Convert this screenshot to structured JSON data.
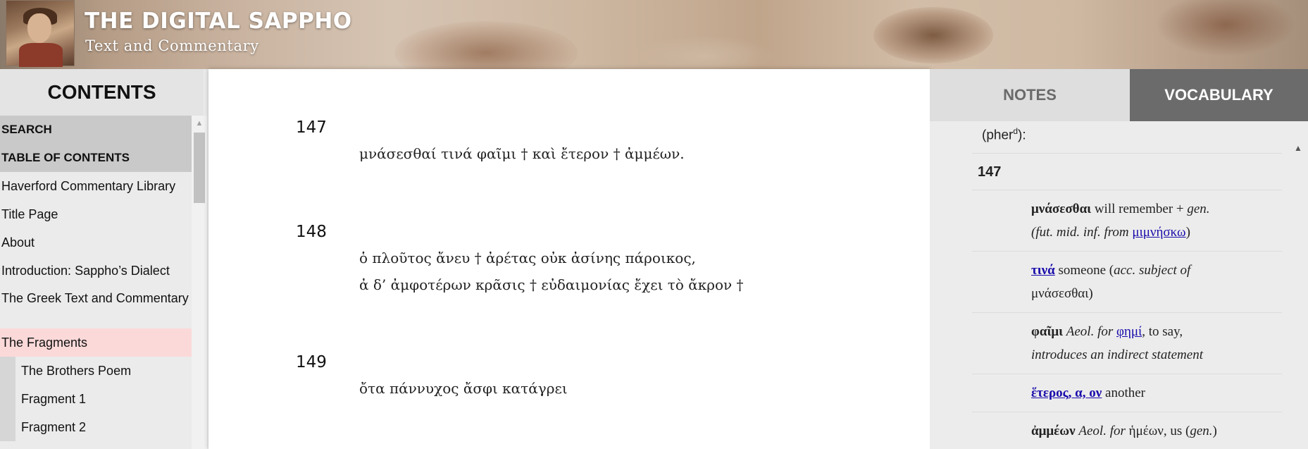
{
  "header": {
    "title": "THE DIGITAL SAPPHO",
    "subtitle": "Text and Commentary",
    "logo_icon": "sappho-portrait"
  },
  "sidebar": {
    "heading": "CONTENTS",
    "sections": [
      "SEARCH",
      "TABLE OF CONTENTS"
    ],
    "items": [
      "Haverford Commentary Library",
      "Title Page",
      "About",
      "Introduction: Sappho’s Dialect",
      "The Greek Text and Commentary",
      "The Fragments"
    ],
    "active_item": "The Fragments",
    "subitems": [
      "The Brothers Poem",
      "Fragment 1",
      "Fragment 2"
    ]
  },
  "main": {
    "fragments": [
      {
        "number": "147",
        "lines": [
          "μνάσεσθαί τινά φαῖμι † καὶ ἔτερον † ἀμμέων."
        ]
      },
      {
        "number": "148",
        "lines": [
          "ὁ πλοῦτος ἄνευ † ἀρέτας οὐκ ἀσίνης πάροικος,",
          "ἀ δ’ ἀμφοτέρων κρᾶσις † εὐδαιμονίας ἔχει τὸ ἄκρον †"
        ]
      },
      {
        "number": "149",
        "lines": [
          "ὄτα πάννυχος ἄσφι κατάγρει"
        ]
      }
    ]
  },
  "right_panel": {
    "tabs": {
      "notes": "NOTES",
      "vocabulary": "VOCABULARY"
    },
    "active_tab": "VOCABULARY",
    "top_line": {
      "text": "(pher",
      "sup": "d",
      "tail": "):"
    },
    "fragment_number": "147",
    "entries": [
      {
        "hw": "μνάσεσθαι",
        "a": " will remember + ",
        "b": "gen.",
        "c": "(fut. mid. inf. from ",
        "link": "μιμνήσκω",
        "d": ")"
      },
      {
        "link": "τινά",
        "a": " someone (",
        "b": "acc. subject of",
        "c": "μνάσεσθαι)"
      },
      {
        "hw": "φαῖμι",
        "a": " Aeol. for ",
        "link": "φημί",
        "b": ", to say,",
        "c": "introduces an indirect statement"
      },
      {
        "link": "ἕτερος, α, ον",
        "a": " another"
      },
      {
        "hw": "ἀμμέων",
        "a": " Aeol. for ",
        "b": "ἡμέων, us (",
        "c": "gen.",
        "d": ")"
      }
    ]
  },
  "colors": {
    "active_item_bg": "#fcd9d9",
    "active_tab_bg": "#6b6b6b",
    "link": "#1a0dab"
  }
}
